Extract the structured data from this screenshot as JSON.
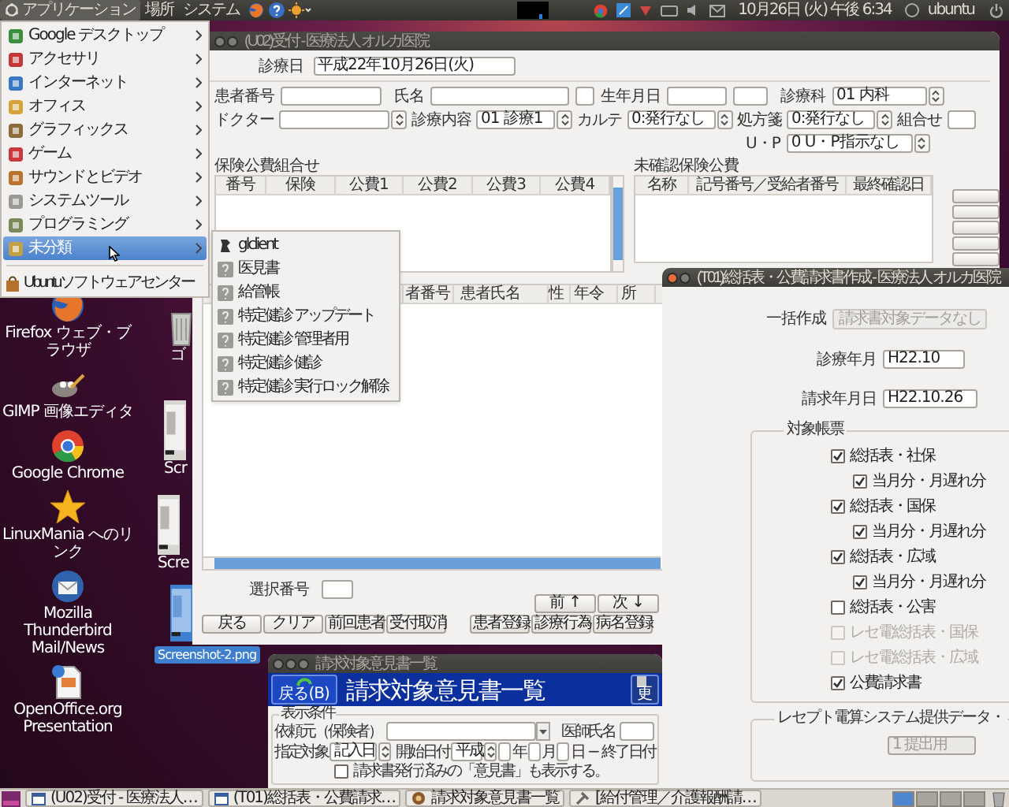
{
  "top_panel": {
    "menus": [
      {
        "label": "アプリケーション",
        "selected": true
      },
      {
        "label": "場所",
        "selected": false
      },
      {
        "label": "システム",
        "selected": false
      }
    ],
    "clock": "10月26日 (火) 午後 6:34",
    "user": "ubuntu"
  },
  "app_menu": {
    "items": [
      {
        "label": "Google デスクトップ",
        "selected": false
      },
      {
        "label": "アクセサリ",
        "selected": false
      },
      {
        "label": "インターネット",
        "selected": false
      },
      {
        "label": "オフィス",
        "selected": false
      },
      {
        "label": "グラフィックス",
        "selected": false
      },
      {
        "label": "ゲーム",
        "selected": false
      },
      {
        "label": "サウンドとビデオ",
        "selected": false
      },
      {
        "label": "システムツール",
        "selected": false
      },
      {
        "label": "プログラミング",
        "selected": false
      },
      {
        "label": "未分類",
        "selected": true
      }
    ],
    "footer_item": "Ubuntuソフトウェアセンター"
  },
  "submenu": {
    "items": [
      {
        "label": "glclient",
        "kind": "client"
      },
      {
        "label": "医見書",
        "kind": "unknown"
      },
      {
        "label": "給管帳",
        "kind": "unknown"
      },
      {
        "label": "特定健診 アップデート",
        "kind": "unknown"
      },
      {
        "label": "特定健診 管理者用",
        "kind": "unknown"
      },
      {
        "label": "特定健診 健診",
        "kind": "unknown"
      },
      {
        "label": "特定健診 実行ロック解除",
        "kind": "unknown"
      }
    ]
  },
  "desktop_icons": [
    {
      "label": "Firefox ウェブ・ブラウザ",
      "kind": "browser"
    },
    {
      "label": "GIMP 画像エディタ",
      "kind": "painter"
    },
    {
      "label": "Google Chrome",
      "kind": "chrome"
    },
    {
      "label": "LinuxMania へのリンク",
      "kind": "link"
    },
    {
      "label": "Mozilla Thunderbird Mail/News",
      "kind": "mail"
    },
    {
      "label": "OpenOffice.org Presentation",
      "kind": "presentation"
    }
  ],
  "desktop_files": [
    {
      "label": "ゴ",
      "kind": "trash",
      "selected": false
    },
    {
      "label": "Scr",
      "kind": "screenshot",
      "selected": false
    },
    {
      "label": "Scre",
      "kind": "screenshot",
      "selected": false
    },
    {
      "label": "Screenshot-2.png",
      "kind": "screenshot",
      "selected": true
    }
  ],
  "reception_window": {
    "title": "(U02)受付 - 医療法人 オルカ医院",
    "active": false,
    "date_label": "診療日",
    "date_value": "平成22年10月26日(火)",
    "patient_number_label": "患者番号",
    "name_label": "氏名",
    "birth_label": "生年月日",
    "dept_label": "診療科",
    "dept_value": "01 内科",
    "doctor_label": "ドクター",
    "content_label": "診療内容",
    "content_value": "01 診療1",
    "chart_label": "カルテ",
    "chart_value": "0:発行なし",
    "rx_label": "処方箋",
    "rx_value": "0:発行なし",
    "combo_label": "組合せ",
    "up_label": "U・P",
    "up_value": "0 U・P指示なし",
    "insurance_table": {
      "title": "保険公費組合せ",
      "columns": [
        "番号",
        "保険",
        "公費1",
        "公費2",
        "公費3",
        "公費4"
      ]
    },
    "unconfirmed_table": {
      "title": "未確認保険公費",
      "columns": [
        "名称",
        "記号番号／受給者番号",
        "最終確認日"
      ]
    },
    "patients_table": {
      "columns": [
        "者番号",
        "患者氏名",
        "性",
        "年令",
        "所"
      ]
    },
    "selection_label": "選択番号",
    "nav_buttons": [
      "前 ↑",
      "次 ↓"
    ],
    "buttons": [
      "戻る",
      "クリア",
      "前回患者",
      "受付取消",
      "患者登録",
      "診療行為",
      "病名登録"
    ]
  },
  "opinion_window": {
    "title": "請求対象意見書一覧",
    "active": false,
    "back_button": "戻る(B)",
    "heading": "請求対象意見書一覧",
    "refresh_button": "更",
    "group": "表示条件",
    "requester_label": "依頼元（保険者）",
    "doctor_label": "医師氏名",
    "target_label": "指定対象",
    "target_value": "記入日",
    "start_label": "開始日付",
    "era_value": "平成",
    "year": "年",
    "month": "月",
    "day": "日",
    "dash": "−",
    "end_label": "終了日付",
    "issued_label": "請求書発行済みの「意見書」も表示する。",
    "issued_checked": false
  },
  "billing_window": {
    "title": "(T01)総括表・公費請求書作成 - 医療法人 オルカ医院",
    "active": true,
    "batch_label": "一括作成",
    "batch_button": {
      "label": "請求書対象データなし",
      "disabled": true
    },
    "month_label": "診療年月",
    "month_value": "H22.10",
    "date_label": "請求年月日",
    "date_value": "H22.10.26",
    "forms_group": "対象帳票",
    "forms": [
      {
        "label": "総括表・社保",
        "checked": true,
        "disabled": false,
        "children": [
          {
            "label": "当月分・月遅れ分",
            "checked": true,
            "disabled": false
          }
        ]
      },
      {
        "label": "総括表・国保",
        "checked": true,
        "disabled": false,
        "children": [
          {
            "label": "当月分・月遅れ分",
            "checked": true,
            "disabled": false
          }
        ]
      },
      {
        "label": "総括表・広域",
        "checked": true,
        "disabled": false,
        "children": [
          {
            "label": "当月分・月遅れ分",
            "checked": true,
            "disabled": false
          }
        ]
      },
      {
        "label": "総括表・公害",
        "checked": false,
        "disabled": false
      },
      {
        "label": "レセ電総括表・国保",
        "checked": false,
        "disabled": true
      },
      {
        "label": "レセ電総括表・広域",
        "checked": false,
        "disabled": true
      },
      {
        "label": "公費請求書",
        "checked": true,
        "disabled": false
      }
    ],
    "receipt_group": "レセプト電算システム提供データ・",
    "receipt_value": "1 提出用",
    "receipt_disabled": true
  },
  "taskbar": {
    "items": [
      {
        "label": "(U02)受付 - 医療法人…",
        "kind": "window"
      },
      {
        "label": "(T01)総括表・公費請求…",
        "kind": "window"
      },
      {
        "label": "請求対象意見書一覧",
        "kind": "app"
      },
      {
        "label": "[給付管理／介護報酬請…",
        "kind": "tool"
      }
    ],
    "workspaces": [
      {
        "selected": true
      },
      {
        "selected": false
      },
      {
        "selected": false
      },
      {
        "selected": false
      }
    ]
  }
}
